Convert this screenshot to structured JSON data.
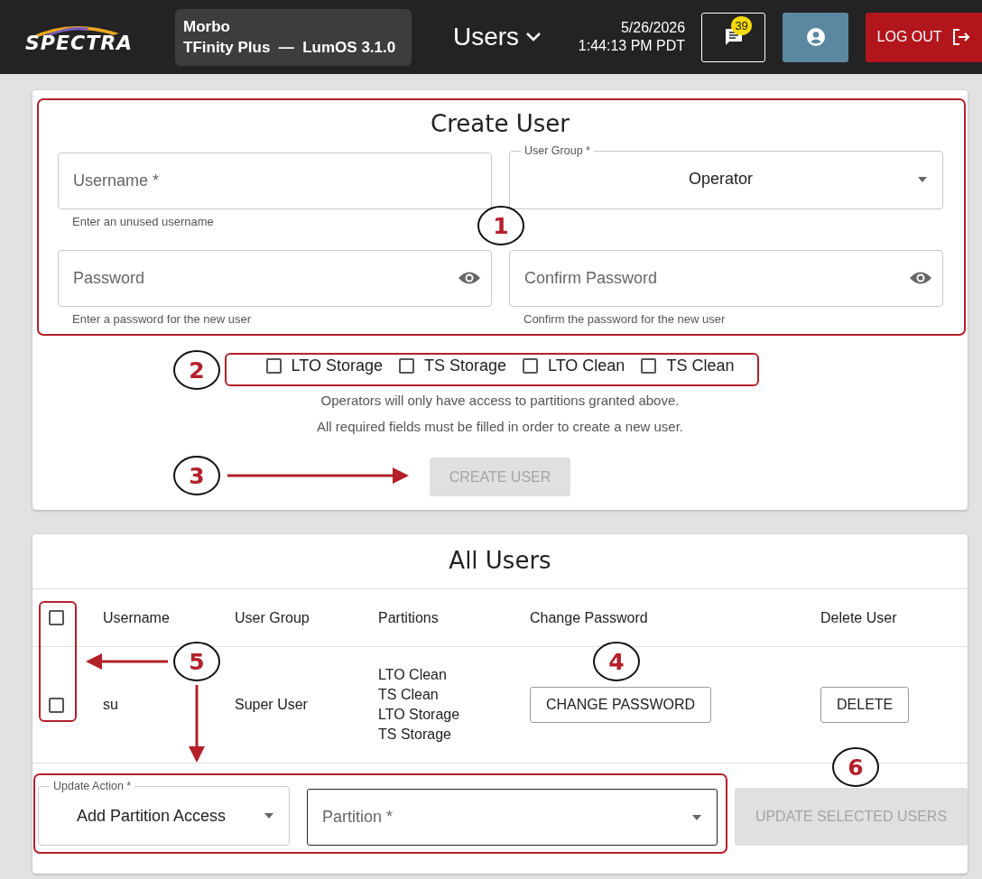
{
  "header": {
    "logo": "SPECTRA",
    "device_name": "Morbo",
    "device_model": "TFinity Plus  —  LumOS 3.1.0",
    "page_menu": "Users",
    "date": "5/26/2026",
    "time": "1:44:13 PM PDT",
    "message_count": "39",
    "logout": "LOG OUT"
  },
  "create_user": {
    "title": "Create User",
    "field_rows": [
      [
        {
          "kind": "text",
          "placeholder": "Username *",
          "helper": "Enter an unused username"
        },
        {
          "kind": "select",
          "label": "User Group *",
          "value": "Operator"
        }
      ],
      [
        {
          "kind": "password",
          "placeholder": "Password",
          "helper": "Enter a password for the new user"
        },
        {
          "kind": "password",
          "placeholder": "Confirm Password",
          "helper": "Confirm the password for the new user"
        }
      ]
    ],
    "partitions": [
      {
        "label": "LTO Storage",
        "checked": false
      },
      {
        "label": "TS Storage",
        "checked": false
      },
      {
        "label": "LTO Clean",
        "checked": false
      },
      {
        "label": "TS Clean",
        "checked": false
      }
    ],
    "notes": [
      "Operators will only have access to partitions granted above.",
      "All required fields must be filled in order to create a new user."
    ],
    "button": {
      "label": "CREATE USER",
      "disabled": true
    }
  },
  "all_users": {
    "title": "All Users",
    "select_all": false,
    "columns": [
      "Username",
      "User Group",
      "Partitions",
      "Change Password",
      "Delete User"
    ],
    "rows": [
      {
        "checked": false,
        "username": "su",
        "user_group": "Super User",
        "partitions": [
          "LTO Clean",
          "TS Clean",
          "LTO Storage",
          "TS Storage"
        ],
        "change_password": "CHANGE PASSWORD",
        "delete": "DELETE"
      }
    ],
    "update_action": {
      "label": "Update Action *",
      "value": "Add Partition Access"
    },
    "partition": {
      "placeholder": "Partition *"
    },
    "update_button": {
      "label": "UPDATE SELECTED USERS",
      "disabled": true
    }
  },
  "callouts": [
    "1",
    "2",
    "3",
    "4",
    "5",
    "6"
  ]
}
